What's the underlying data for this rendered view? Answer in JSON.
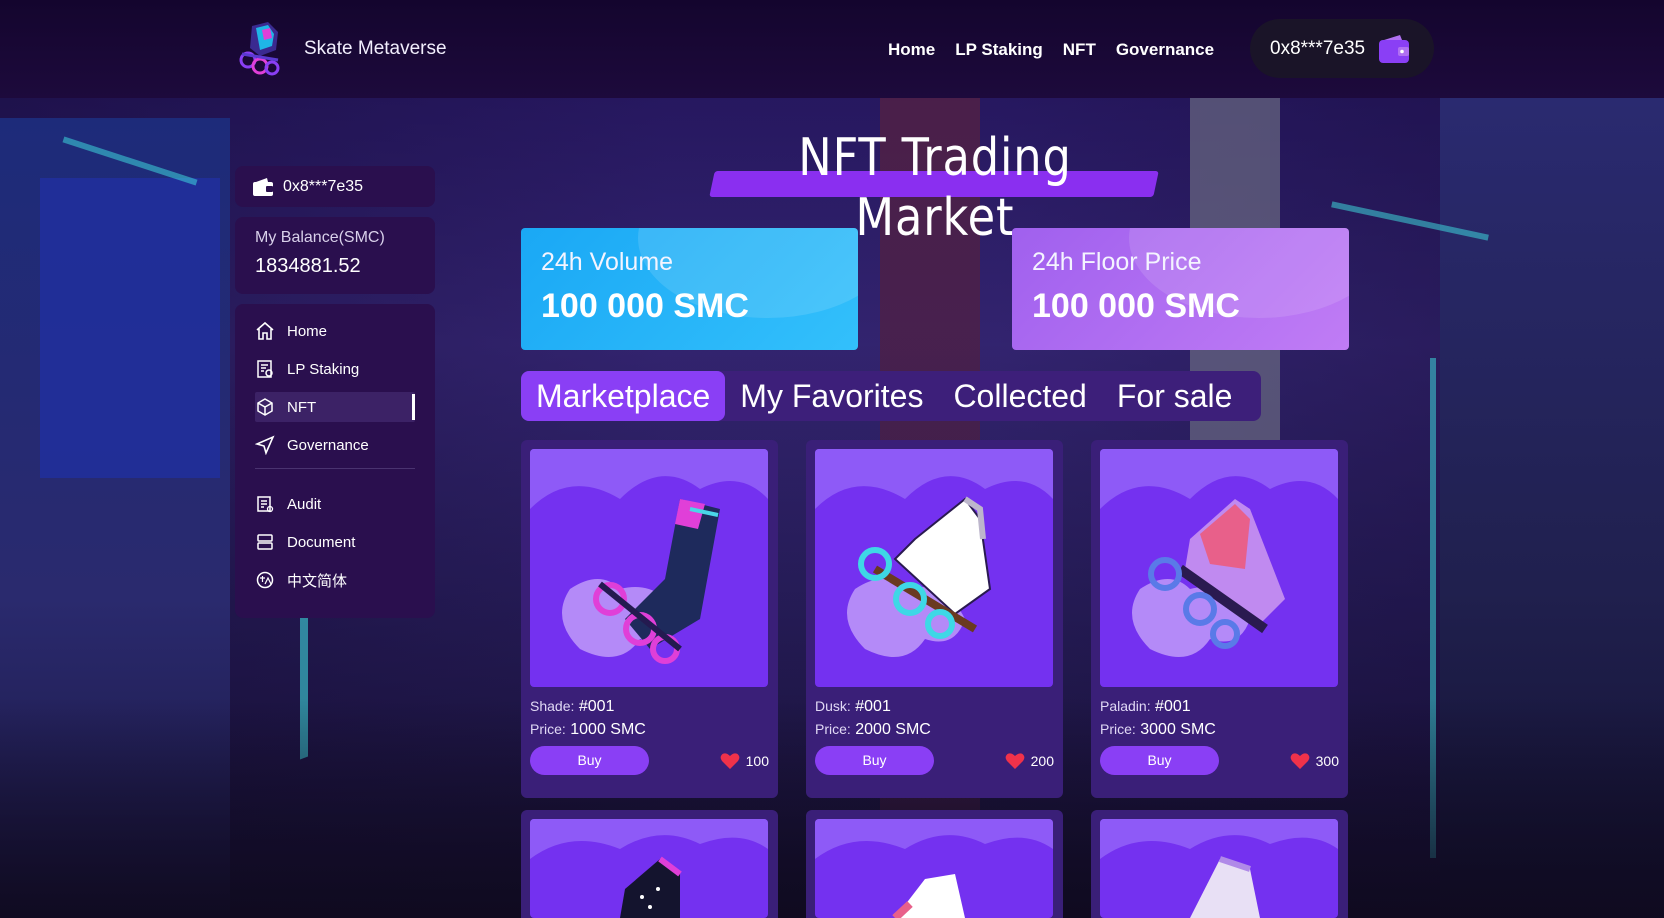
{
  "header": {
    "brand": "Skate Metaverse",
    "nav": [
      "Home",
      "LP Staking",
      "NFT",
      "Governance"
    ],
    "wallet_address": "0x8***7e35"
  },
  "sidebar": {
    "wallet_address": "0x8***7e35",
    "balance_label": "My Balance(SMC)",
    "balance_value": "1834881.52",
    "items": [
      {
        "label": "Home",
        "icon": "home-icon"
      },
      {
        "label": "LP Staking",
        "icon": "staking-icon"
      },
      {
        "label": "NFT",
        "icon": "cube-icon",
        "active": true
      },
      {
        "label": "Governance",
        "icon": "send-icon"
      }
    ],
    "items2": [
      {
        "label": "Audit",
        "icon": "audit-icon"
      },
      {
        "label": "Document",
        "icon": "document-icon"
      },
      {
        "label": "中文简体",
        "icon": "language-icon"
      }
    ]
  },
  "main": {
    "title": "NFT Trading Market",
    "stats": {
      "volume_label": "24h Volume",
      "volume_value": "100 000 SMC",
      "floor_label": "24h Floor Price",
      "floor_value": "100 000 SMC"
    },
    "tabs": [
      "Marketplace",
      "My Favorites",
      "Collected",
      "For sale"
    ],
    "cards": [
      {
        "name_key": "Shade:",
        "name_val": "#001",
        "price_key": "Price:",
        "price_val": "1000 SMC",
        "buy": "Buy",
        "likes": "100",
        "color": "#1e2a5c"
      },
      {
        "name_key": "Dusk:",
        "name_val": "#001",
        "price_key": "Price:",
        "price_val": "2000 SMC",
        "buy": "Buy",
        "likes": "200",
        "color": "#ffffff"
      },
      {
        "name_key": "Paladin:",
        "name_val": "#001",
        "price_key": "Price:",
        "price_val": "3000 SMC",
        "buy": "Buy",
        "likes": "300",
        "color": "#e8608a"
      }
    ]
  },
  "colors": {
    "accent": "#8a3ff5",
    "header_bg": "#1a0838",
    "panel_bg": "#2a0f4e",
    "card_bg": "#3a1f78",
    "volume_card": "#1aa8f5",
    "floor_card": "#b070f2",
    "like_heart": "#f0324a"
  }
}
